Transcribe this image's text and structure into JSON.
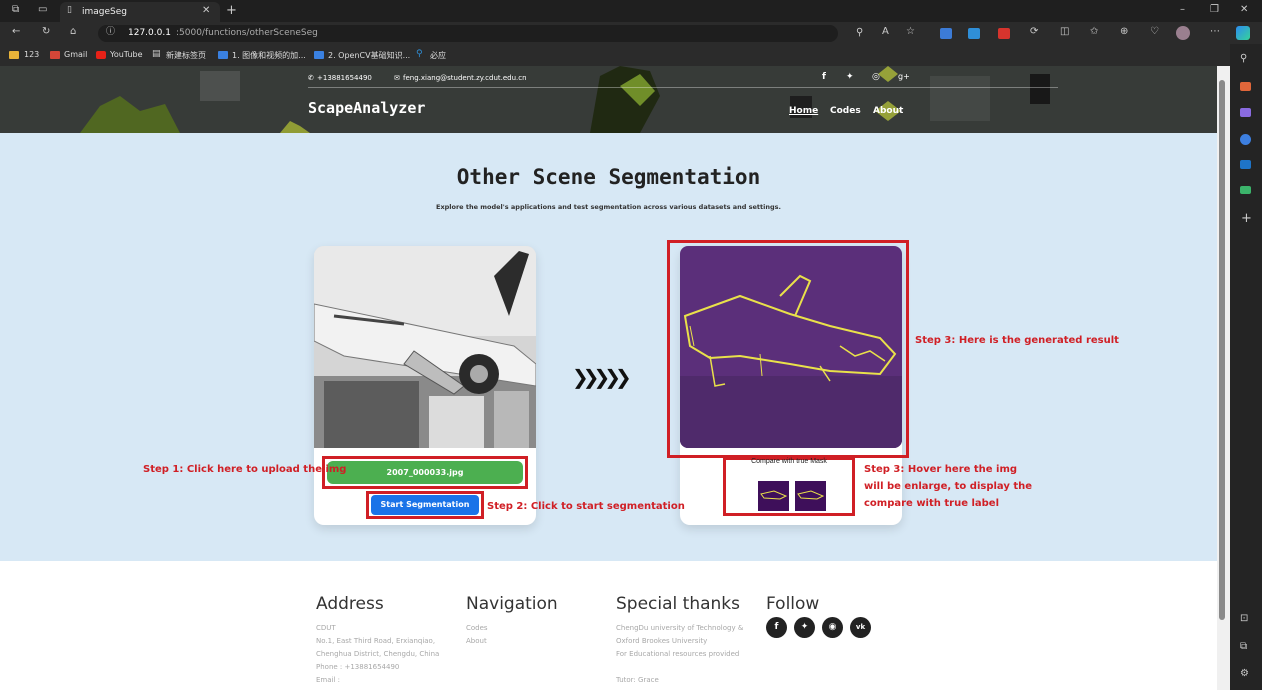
{
  "browser": {
    "tab_title": "imageSeg",
    "url_host": "127.0.0.1",
    "url_rest": ":5000/functions/otherSceneSeg",
    "bookmarks": [
      "123",
      "Gmail",
      "YouTube",
      "新建标签页",
      "1. 图像和视频的加...",
      "2. OpenCV基础知识...",
      "必应"
    ]
  },
  "site": {
    "phone": "+13881654490",
    "email": "feng.xiang@student.zy.cdut.edu.cn",
    "logo": "ScapeAnalyzer",
    "nav": [
      "Home",
      "Codes",
      "About"
    ],
    "social_top": [
      "f",
      "t",
      "in",
      "g+"
    ]
  },
  "main": {
    "title": "Other Scene Segmentation",
    "subtitle": "Explore the model's applications and test segmentation across various datasets and settings.",
    "file_button": "2007_000033.jpg",
    "start_button": "Start Segmentation",
    "compare_label": "Compare with true Mask",
    "arrows": "❯❯❯❯❯"
  },
  "annotations": {
    "step1": "Step 1: Click here to upload the img",
    "step2": "Step 2: Click to start segmentation",
    "step3a": "Step 3: Here is the generated result",
    "step3b_line1": "Step 3: Hover here the img",
    "step3b_line2": "will be enlarge, to display the",
    "step3b_line3": "compare with true label"
  },
  "footer": {
    "address_title": "Address",
    "address_lines": [
      "CDUT",
      "No.1, East Third Road, Erxianqiao,",
      "Chenghua District, Chengdu, China",
      "Phone : +13881654490",
      "Email :"
    ],
    "nav_title": "Navigation",
    "nav_links": [
      "Codes",
      "About"
    ],
    "thanks_title": "Special thanks",
    "thanks_lines": [
      "ChengDu university of Technology &",
      "Oxford Brookes University",
      "For Educational resources provided",
      "",
      "Tutor: Grace"
    ],
    "follow_title": "Follow",
    "follow_icons": [
      "f",
      "t",
      "rss",
      "vk"
    ]
  },
  "colors": {
    "accent_green": "#4caf50",
    "accent_blue": "#1a73e8",
    "annotation_red": "#d01f25",
    "mask_purple": "#5b2f7a",
    "mask_yellow": "#e9e14a"
  }
}
